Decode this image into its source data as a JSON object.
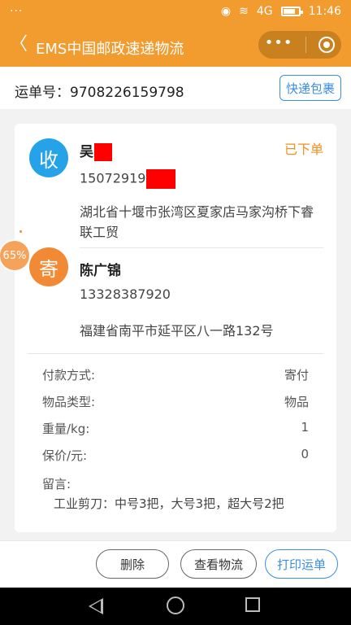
{
  "status_bar": {
    "time": "11:46",
    "network": "4G"
  },
  "nav": {
    "title": "EMS中国邮政速递物流"
  },
  "tracking": {
    "label": "运单号：",
    "number": "9708226159798",
    "express_button": "快递包裹"
  },
  "receiver": {
    "badge": "收",
    "name": "吴",
    "phone": "15072919",
    "address": "湖北省十堰市张湾区夏家店马家沟桥下睿联工贸",
    "status": "已下单"
  },
  "sender": {
    "badge": "寄",
    "name": "陈广锦",
    "phone": "13328387920",
    "address": "福建省南平市延平区八一路132号"
  },
  "details": [
    {
      "label": "付款方式:",
      "value": "寄付"
    },
    {
      "label": "物品类型:",
      "value": "物品"
    },
    {
      "label": "重量/kg:",
      "value": "1"
    },
    {
      "label": "保价/元:",
      "value": "0"
    }
  ],
  "note": {
    "label": "留言:",
    "text": "工业剪刀：中号3把，大号3把，超大号2把"
  },
  "floating_badge": "65%",
  "actions": {
    "delete": "删除",
    "view_logistics": "查看物流",
    "print_waybill": "打印运单"
  }
}
